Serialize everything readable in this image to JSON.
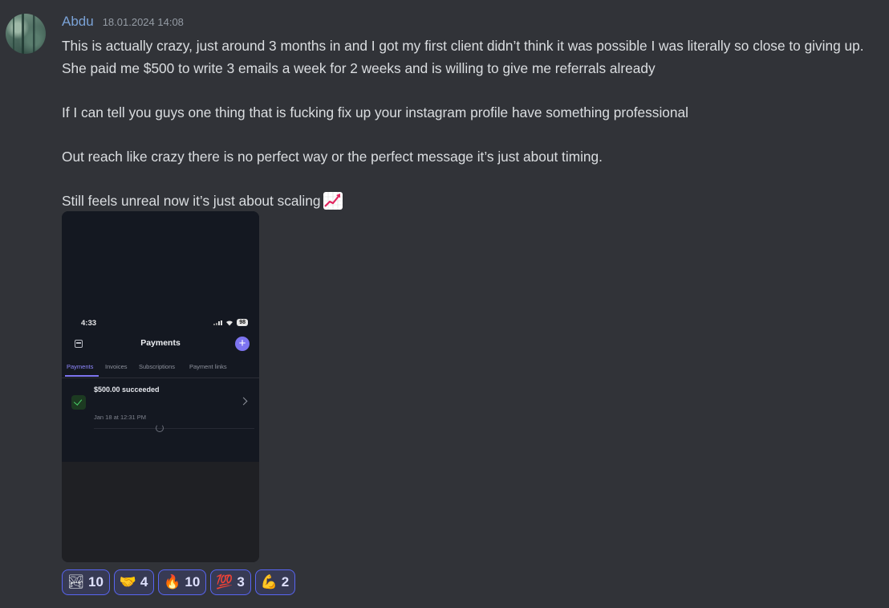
{
  "message": {
    "author": "Abdu",
    "timestamp": "18.01.2024 14:08",
    "paragraphs": [
      "This is actually crazy, just around 3 months in and I got my first client didn’t think it was possible I was literally so close to giving up. She paid me $500 to write 3 emails a week for 2 weeks and is willing to give me referrals already",
      "If I can tell you guys one thing that is fucking fix up your instagram profile have something professional",
      "Out reach like crazy there is no perfect way or the perfect message it’s just about timing.",
      "Still feels unreal now it’s just about scaling"
    ],
    "trailing_emoji": "chart-increasing-icon"
  },
  "attachment": {
    "time": "4:33",
    "battery": "98",
    "title": "Payments",
    "plus": "+",
    "tabs": [
      "Payments",
      "Invoices",
      "Subscriptions",
      "Payment links"
    ],
    "active_tab": "Payments",
    "payment_amount": "$500.00 succeeded",
    "payment_date": "Jan 18 at 12:31 PM"
  },
  "reactions": [
    {
      "emoji": "🏞",
      "icon": "scenery-emoji-icon",
      "count": "10"
    },
    {
      "emoji": "🤝",
      "icon": "handshake-emoji-icon",
      "count": "4"
    },
    {
      "emoji": "🔥",
      "icon": "fire-emoji-icon",
      "count": "10"
    },
    {
      "emoji": "💯",
      "icon": "hundred-emoji-icon",
      "count": "3"
    },
    {
      "emoji": "💪",
      "icon": "flexed-biceps-emoji-icon",
      "count": "2"
    }
  ],
  "colors": {
    "background": "#313338",
    "username": "#7aa2d6",
    "reaction_border": "#5865f2",
    "accent_purple": "#7d74f0",
    "success_green": "#4bd36a"
  }
}
